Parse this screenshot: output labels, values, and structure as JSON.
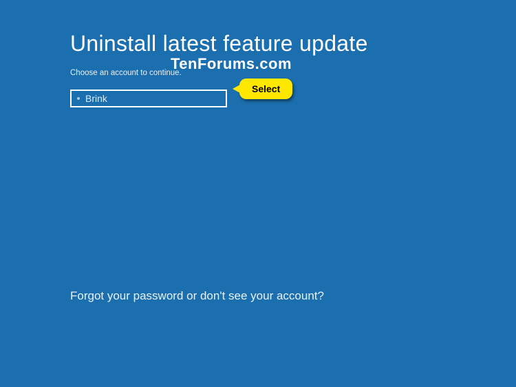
{
  "header": {
    "title": "Uninstall latest feature update",
    "subtitle": "Choose an account to continue."
  },
  "accounts": [
    {
      "name": "Brink"
    }
  ],
  "annotation": {
    "callout_label": "Select",
    "watermark": "TenForums.com"
  },
  "footer": {
    "forgot_link": "Forgot your password or don't see your account?"
  }
}
